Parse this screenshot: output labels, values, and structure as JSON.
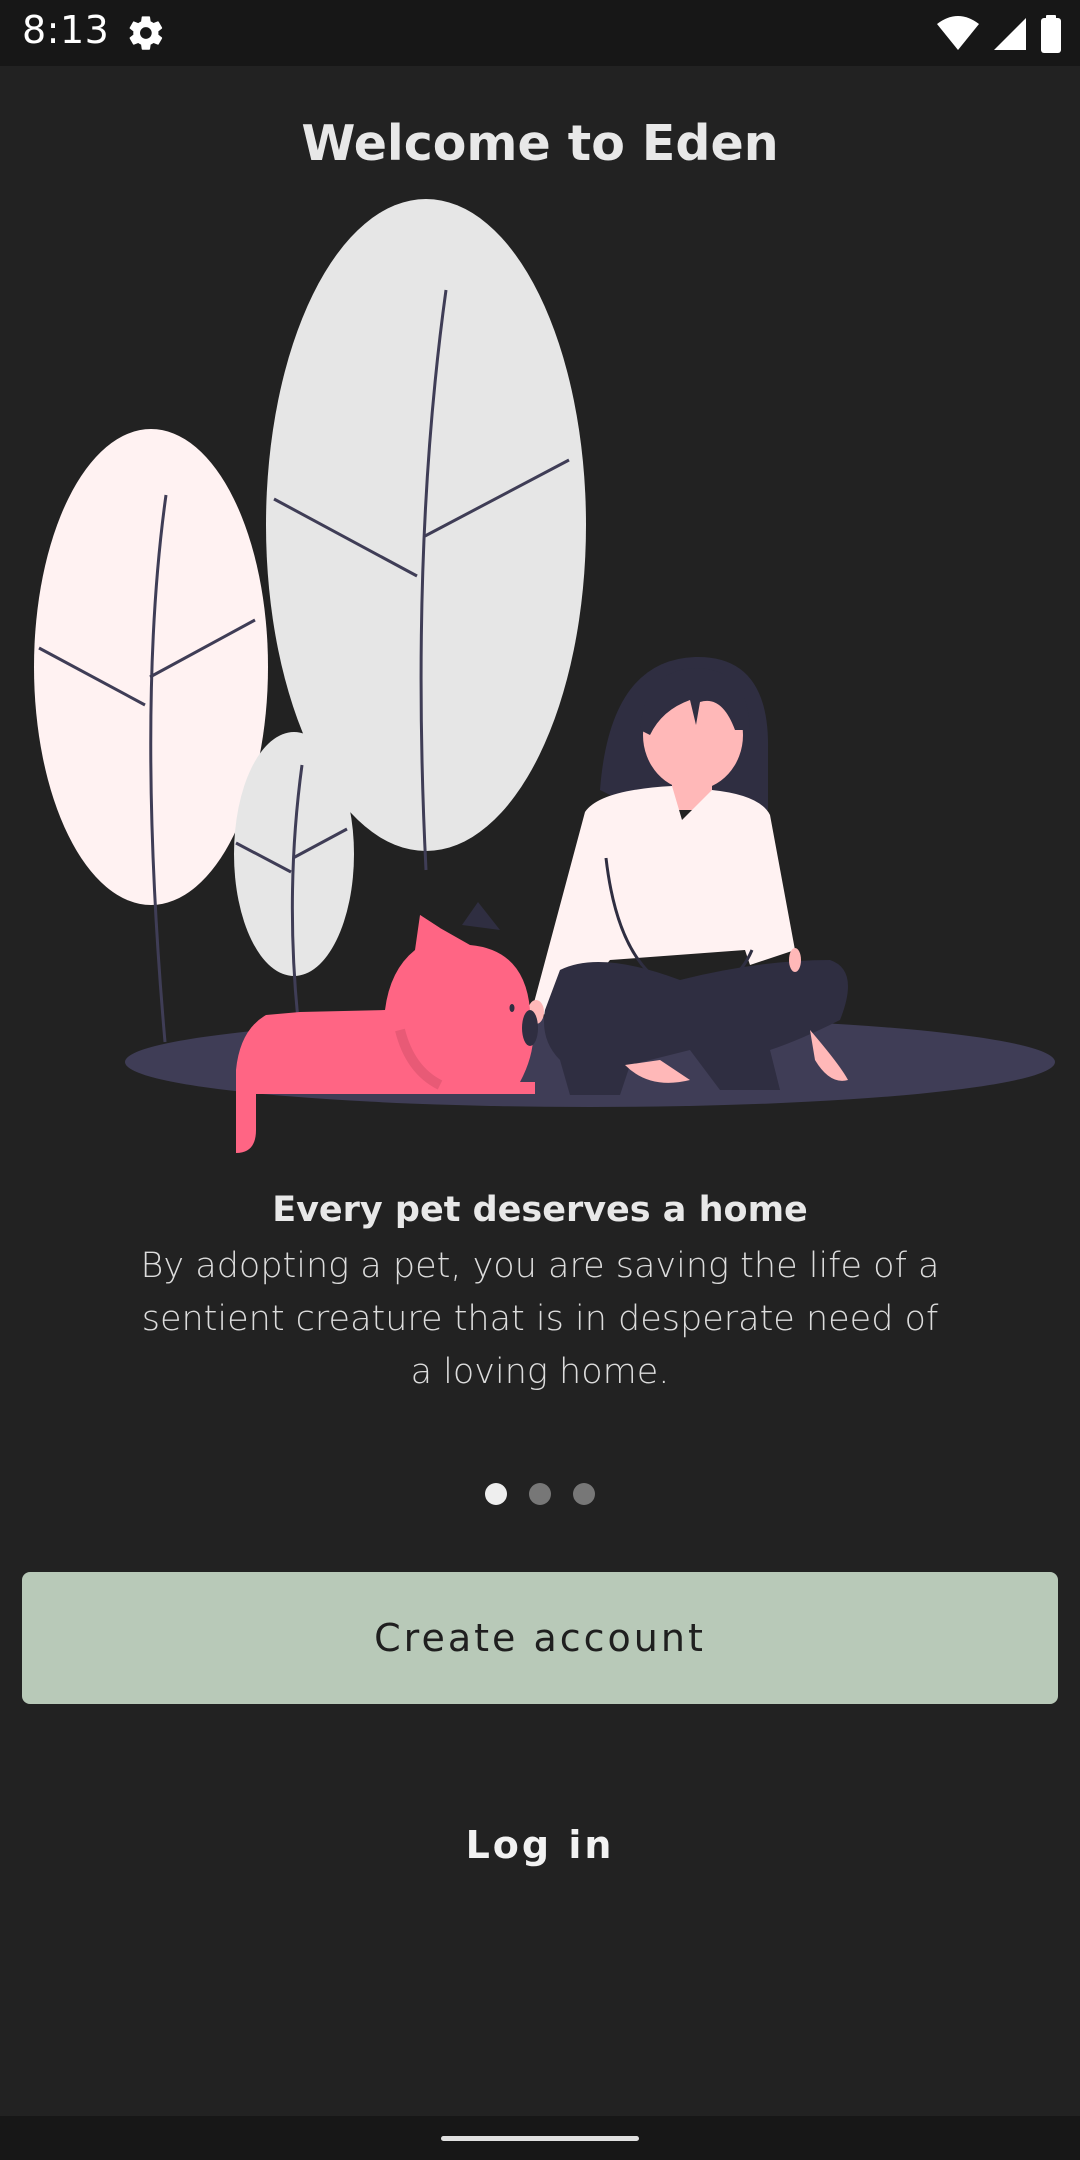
{
  "status_bar": {
    "time": "8:13",
    "icons": [
      "gear-icon",
      "wifi-icon",
      "signal-icon",
      "battery-icon"
    ]
  },
  "page": {
    "title": "Welcome to Eden"
  },
  "illustration": {
    "name": "woman-with-cat-under-trees",
    "colors": {
      "leaf_light": "#e6e6e6",
      "leaf_pink": "#fff2f2",
      "ground": "#3f3d56",
      "cat": "#ff6584",
      "shirt": "#fff2f2",
      "hair": "#2f2e41",
      "skin": "#ffb8b8"
    }
  },
  "slide": {
    "heading": "Every pet deserves a home",
    "body": "By adopting a pet, you are saving the life of a sentient creature that is in desperate need of a loving home.",
    "pages": 3,
    "active_index": 0
  },
  "actions": {
    "create_account": "Create account",
    "log_in": "Log in"
  },
  "colors": {
    "background": "#222222",
    "primary_button": "#b8c9b8"
  }
}
